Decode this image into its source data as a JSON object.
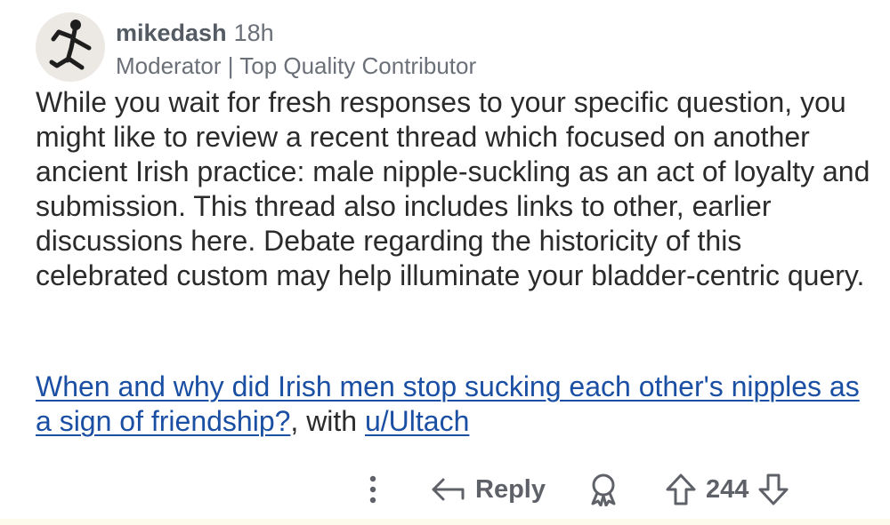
{
  "comment": {
    "author": "mikedash",
    "age": "18h",
    "flair": "Moderator | Top Quality Contributor",
    "body": "While you wait for fresh responses to your specific question, you might like to review a recent thread which focused on another ancient Irish practice: male nipple-suckling as an act of loyalty and submission. This thread also includes links to other, earlier discussions here. Debate regarding the historicity of this celebrated custom may help illuminate your bladder-centric query.",
    "link_text": "When and why did Irish men stop sucking each other's nipples as a sign of friendship?",
    "link_separator": ", with ",
    "user_link": "u/Ultach"
  },
  "actions": {
    "more_icon": "vertical-ellipsis-icon",
    "reply_label": "Reply",
    "award_icon": "award-icon",
    "score": "244"
  },
  "colors": {
    "link": "#1a4fa3",
    "meta": "#6b7078",
    "text": "#2b2b2b",
    "actions": "#5e6268"
  }
}
